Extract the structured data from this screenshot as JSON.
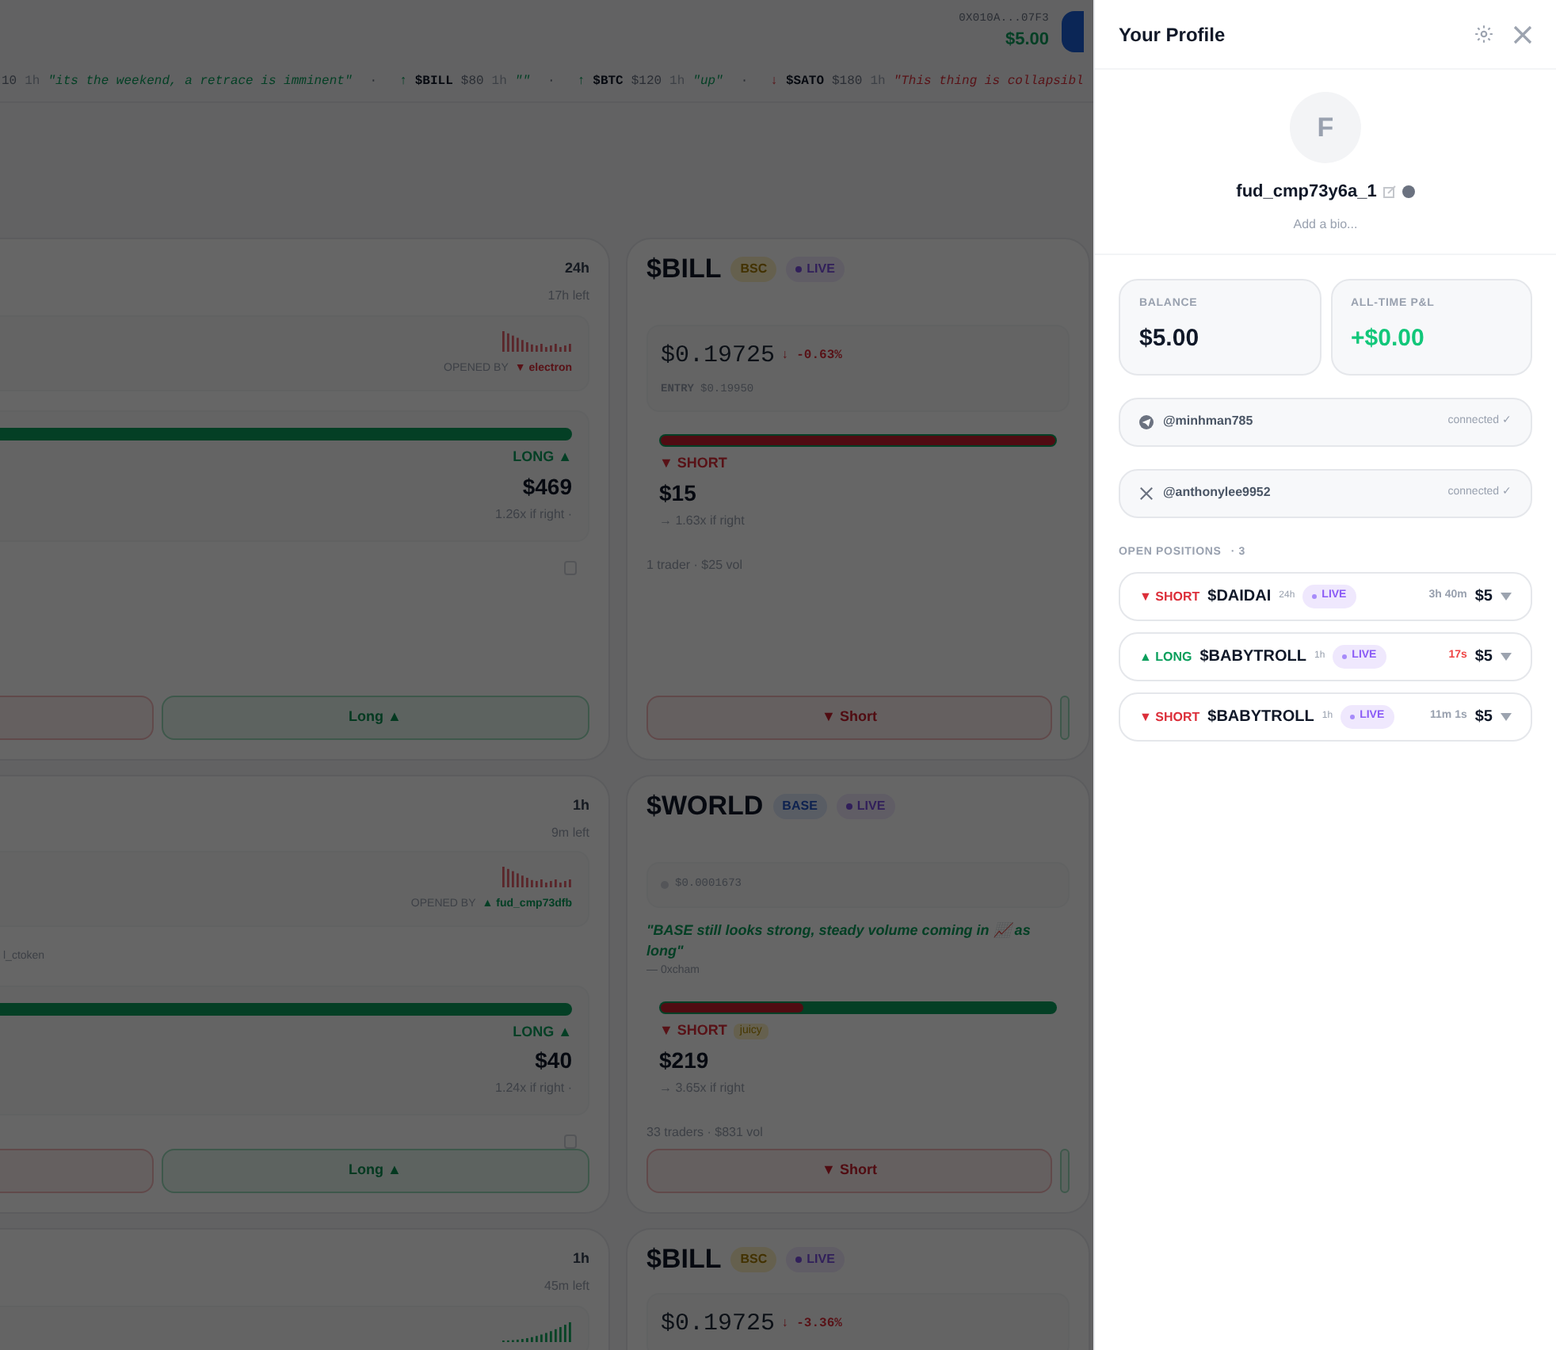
{
  "header": {
    "wallet": "0X010A...07F3",
    "balance": "$5.00"
  },
  "ticker": [
    {
      "kind": "up",
      "amount": "10",
      "timeframe": "1h",
      "quote": "\"its the weekend, a retrace is imminent\"",
      "sep": "·"
    },
    {
      "kind": "up",
      "arrow": "↑",
      "ticker": "$BILL",
      "amount": "$80",
      "timeframe": "1h",
      "quote": "\"\"",
      "sep": "·"
    },
    {
      "kind": "up",
      "arrow": "↑",
      "ticker": "$BTC",
      "amount": "$120",
      "timeframe": "1h",
      "quote": "\"up\"",
      "sep": "·"
    },
    {
      "kind": "down",
      "arrow": "↓",
      "ticker": "$SATO",
      "amount": "$180",
      "timeframe": "1h",
      "quote": "\"This thing is collapsibl"
    }
  ],
  "cards": [
    {
      "timeframe": "24h",
      "time_left": "17h left",
      "sparkline": {
        "kind": "down"
      },
      "opened_by_label": "OPENED BY",
      "opener": {
        "kind": "short",
        "label": "▼ electron"
      },
      "level": 0,
      "side": {
        "kind": "long",
        "label": "LONG ▲",
        "amount": "$469",
        "payout": "1.26x if right ·"
      },
      "share_icon": true,
      "buttons": [
        {
          "kind": "short"
        },
        {
          "kind": "long",
          "label": "Long ▲"
        }
      ]
    },
    {
      "title": "$BILL",
      "chain": {
        "kind": "bsc",
        "label": "BSC"
      },
      "status": "LIVE",
      "price": {
        "value": "$0.19725",
        "change": "↓ -0.63%",
        "kind": "down",
        "entry_label": "ENTRY",
        "entry": "$0.19950"
      },
      "level": 1,
      "side": {
        "kind": "short",
        "label": "▼ SHORT",
        "amount": "$15",
        "payout": "→ 1.63x if right"
      },
      "stats": "1 trader · $25 vol",
      "buttons": [
        {
          "kind": "short",
          "label": "▼ Short"
        },
        {
          "kind": "long"
        }
      ]
    },
    {
      "timeframe": "1h",
      "time_left": "9m left",
      "sparkline": {
        "kind": "down"
      },
      "opened_by_label": "OPENED BY",
      "opener": {
        "kind": "long",
        "label": "▲ fud_cmp73dfb"
      },
      "tag": "l_ctoken",
      "level": 0,
      "side": {
        "kind": "long",
        "label": "LONG ▲",
        "amount": "$40",
        "payout": "1.24x if right ·"
      },
      "share_icon": true,
      "buttons": [
        {
          "kind": "short"
        },
        {
          "kind": "long",
          "label": "Long ▲"
        }
      ]
    },
    {
      "title": "$WORLD",
      "chain": {
        "kind": "base",
        "label": "BASE"
      },
      "status": "LIVE",
      "price_note": "$0.0001673",
      "quote": {
        "text": "\"BASE still looks strong, steady volume coming in 📈 as long\"",
        "author": "— 0xcham"
      },
      "level": 0.36,
      "side": {
        "kind": "short",
        "label": "▼ SHORT",
        "tag": "juicy",
        "amount": "$219",
        "payout": "→ 3.65x if right"
      },
      "stats": "33 traders · $831 vol",
      "buttons": [
        {
          "kind": "short",
          "label": "▼ Short"
        },
        {
          "kind": "long"
        }
      ]
    },
    {
      "timeframe": "1h",
      "time_left": "45m left",
      "sparkline": {
        "kind": "up"
      }
    },
    {
      "title": "$BILL",
      "chain": {
        "kind": "bsc",
        "label": "BSC"
      },
      "status": "LIVE",
      "price": {
        "value": "$0.19725",
        "change": "↓ -3.36%",
        "kind": "down"
      }
    }
  ],
  "profile": {
    "title": "Your Profile",
    "avatar": "F",
    "username": "fud_cmp73y6a_1",
    "bio_placeholder": "Add a bio...",
    "stats": [
      {
        "label": "BALANCE",
        "value": "$5.00",
        "kind": "plain"
      },
      {
        "label": "ALL-TIME P&L",
        "value": "+$0.00",
        "kind": "gain"
      }
    ],
    "connections": [
      {
        "kind": "telegram",
        "handle": "@minhman785",
        "status": "connected ✓"
      },
      {
        "kind": "x",
        "handle": "@anthonylee9952",
        "status": "connected ✓"
      }
    ],
    "positions_label": "OPEN POSITIONS",
    "positions_count": "· 3",
    "positions": [
      {
        "kind": "short",
        "side_label": "▼ SHORT",
        "ticker": "$DAIDAI",
        "timeframe": "24h",
        "status": "LIVE",
        "remaining": "3h 40m",
        "urgent": false,
        "amount": "$5"
      },
      {
        "kind": "long",
        "side_label": "▲ LONG",
        "ticker": "$BABYTROLL",
        "timeframe": "1h",
        "status": "LIVE",
        "remaining": "17s",
        "urgent": true,
        "amount": "$5"
      },
      {
        "kind": "short",
        "side_label": "▼ SHORT",
        "ticker": "$BABYTROLL",
        "timeframe": "1h",
        "status": "LIVE",
        "remaining": "11m 1s",
        "urgent": false,
        "amount": "$5"
      }
    ]
  }
}
